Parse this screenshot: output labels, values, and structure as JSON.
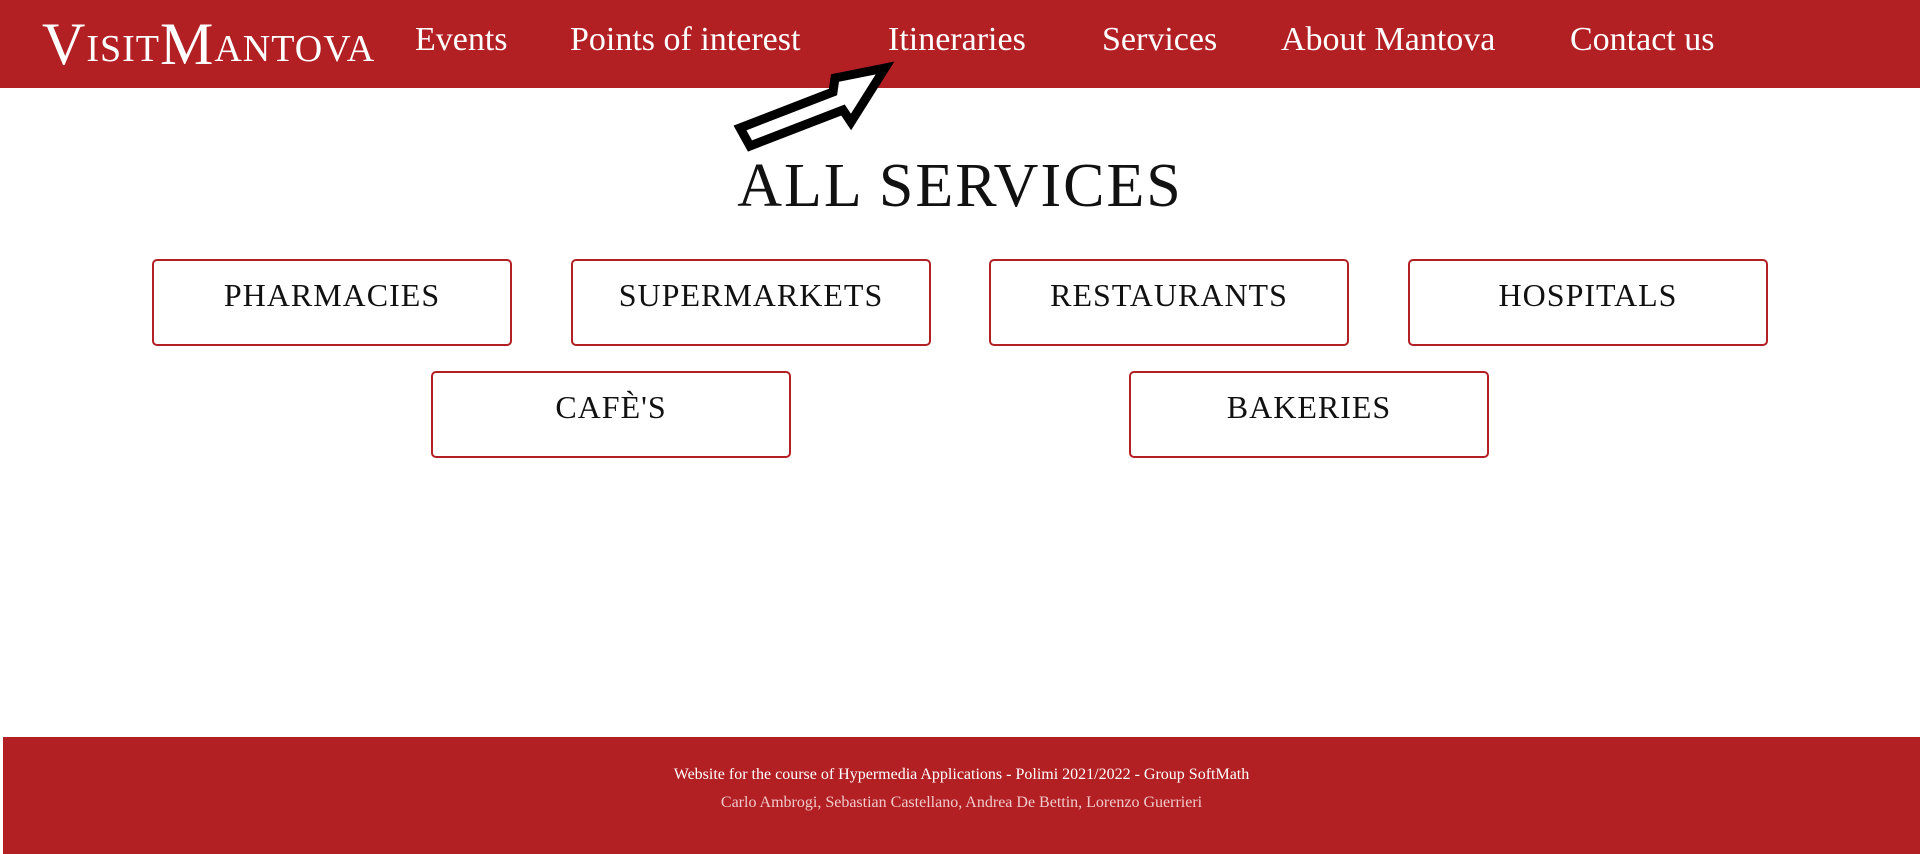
{
  "header": {
    "logo_first_cap": "V",
    "logo_first_rest": "isit",
    "logo_second_cap": "M",
    "logo_second_rest": "antova",
    "nav": [
      {
        "label": "Events"
      },
      {
        "label": "Points of interest"
      },
      {
        "label": "Itineraries"
      },
      {
        "label": "Services"
      },
      {
        "label": "About Mantova"
      },
      {
        "label": "Contact us"
      }
    ]
  },
  "main": {
    "title": "All services",
    "services": [
      {
        "label": "Pharmacies"
      },
      {
        "label": "Supermarkets"
      },
      {
        "label": "Restaurants"
      },
      {
        "label": "Hospitals"
      },
      {
        "label": "Cafè's"
      },
      {
        "label": "Bakeries"
      }
    ]
  },
  "footer": {
    "line1": "Website for the course of Hypermedia Applications - Polimi 2021/2022 - Group SoftMath",
    "line2": "Carlo Ambrogi, Sebastian Castellano, Andrea De Bettin, Lorenzo Guerrieri"
  },
  "colors": {
    "brand": "#b22024",
    "text": "#111111",
    "background": "#ffffff"
  },
  "icons": {
    "pointer": "cursor-arrow-icon"
  }
}
